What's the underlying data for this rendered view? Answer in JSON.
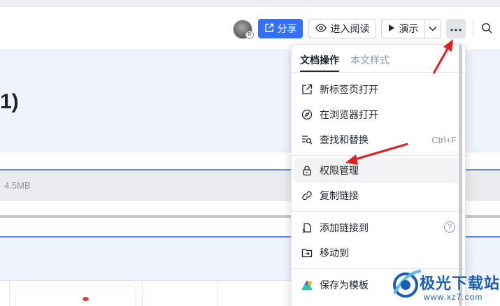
{
  "toolbar": {
    "avatar_badge": "R",
    "share_label": "分享",
    "read_label": "进入阅读",
    "present_label": "演示"
  },
  "document": {
    "title_fragment": "1)",
    "file_size": "4.5MB"
  },
  "menu": {
    "tabs": [
      {
        "label": "文档操作",
        "active": true
      },
      {
        "label": "本文样式",
        "active": false
      }
    ],
    "items": [
      {
        "label": "新标签页打开",
        "icon": "open-new-tab-icon"
      },
      {
        "label": "在浏览器打开",
        "icon": "compass-icon"
      },
      {
        "label": "查找和替换",
        "icon": "find-replace-icon",
        "shortcut": "Ctrl+F"
      },
      {
        "label": "权限管理",
        "icon": "lock-icon"
      },
      {
        "label": "复制链接",
        "icon": "link-icon"
      },
      {
        "label": "添加链接到",
        "icon": "add-link-icon",
        "help": "?"
      },
      {
        "label": "移动到",
        "icon": "folder-move-icon"
      },
      {
        "label": "保存为模板",
        "icon": "template-icon"
      }
    ]
  },
  "watermark": {
    "name": "极光下载站",
    "url": "www.xz7.com"
  },
  "colors": {
    "accent": "#3370ff",
    "annotation_arrow": "#e02020"
  }
}
